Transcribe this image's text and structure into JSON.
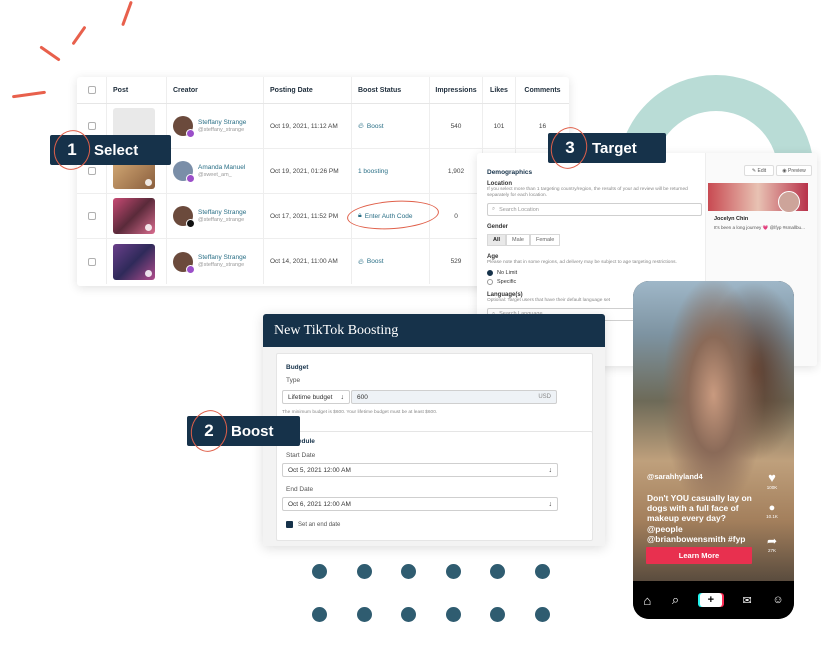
{
  "table": {
    "headers": [
      "Post",
      "Creator",
      "Posting Date",
      "Boost Status",
      "Impressions",
      "Likes",
      "Comments"
    ],
    "rows": [
      {
        "creator_name": "Steffany Strange",
        "creator_handle": "@steffany_strange",
        "date": "Oct 19, 2021, 11:12 AM",
        "status": "Boost",
        "impressions": "540",
        "likes": "101",
        "comments": "16"
      },
      {
        "creator_name": "Amanda Manuel",
        "creator_handle": "@sweet_am_",
        "date": "Oct 19, 2021, 01:26 PM",
        "status": "1 boosting",
        "impressions": "1,902",
        "likes": "",
        "comments": ""
      },
      {
        "creator_name": "Steffany Strange",
        "creator_handle": "@steffany_strange",
        "date": "Oct 17, 2021, 11:52 PM",
        "status": "Enter Auth Code",
        "impressions": "0",
        "likes": "",
        "comments": ""
      },
      {
        "creator_name": "Steffany Strange",
        "creator_handle": "@steffany_strange",
        "date": "Oct 14, 2021, 11:00 AM",
        "status": "Boost",
        "impressions": "529",
        "likes": "",
        "comments": ""
      }
    ]
  },
  "steps": {
    "select": {
      "num": "1",
      "word": "Select"
    },
    "boost": {
      "num": "2",
      "word": "Boost"
    },
    "target": {
      "num": "3",
      "word": "Target"
    }
  },
  "target": {
    "title": "Demographics",
    "location_label": "Location",
    "location_help": "If you select more than 1 targeting country/region, the results of your ad review will be returned separately for each location.",
    "location_placeholder": "Search Location",
    "gender_label": "Gender",
    "gender_options": [
      "All",
      "Male",
      "Female"
    ],
    "age_label": "Age",
    "age_help": "Please note that in some regions, ad delivery may be subject to age targeting restrictions.",
    "age_options": [
      "No Limit",
      "Specific"
    ],
    "language_label": "Language(s)",
    "language_help": "Optional: Target users that have their default language set",
    "language_placeholder": "Search Language",
    "preview_edit": "Edit",
    "preview_preview": "Preview",
    "preview_name": "Jocelyn Chin",
    "preview_bio": "It's been a long journey 💗 @lfyp #smallbu..."
  },
  "boosting": {
    "title": "New TikTok Boosting",
    "budget_title": "Budget",
    "type_label": "Type",
    "type_value": "Lifetime budget",
    "amount_value": "600",
    "currency": "USD",
    "budget_note": "The minimum budget is $600. Your lifetime budget must be at least $600.",
    "schedule_title": "Schedule",
    "start_label": "Start Date",
    "start_value": "Oct 5, 2021 12:00 AM",
    "end_label": "End Date",
    "end_value": "Oct 6, 2021 12:00 AM",
    "end_checkbox_label": "Set an end date"
  },
  "phone": {
    "username": "@sarahhyland4",
    "caption": "Don't YOU casually lay on dogs with a full face of makeup every day? @people @brianbowensmith #fyp",
    "cta": "Learn More",
    "likes": "100K",
    "comments": "10.1K",
    "shares": "27K"
  },
  "colors": {
    "navy": "#16324a",
    "teal_link": "#2a6f86",
    "accent_red": "#e0604a",
    "tiktok_red": "#e8304f",
    "ring_teal": "#b9dcd6",
    "dot_blue": "#2f5c70"
  }
}
